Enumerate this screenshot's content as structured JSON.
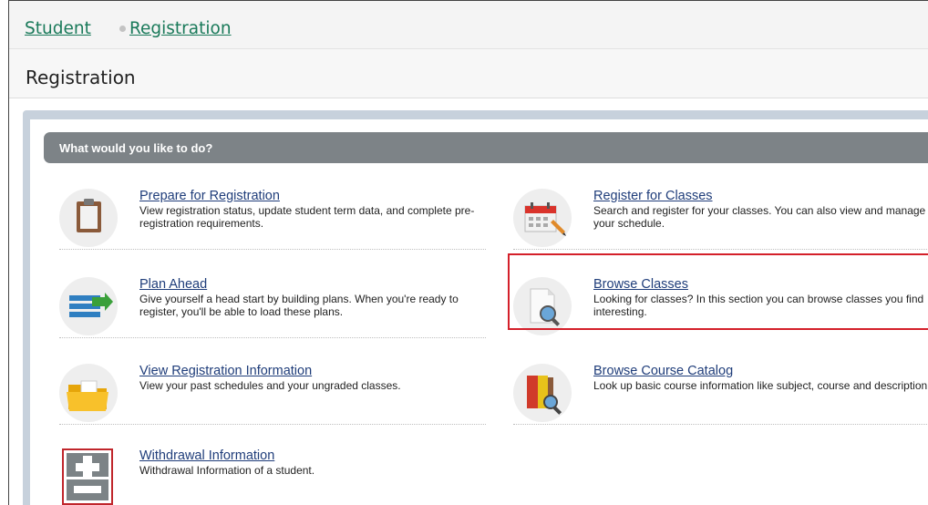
{
  "breadcrumb": {
    "items": [
      "Student",
      "Registration"
    ]
  },
  "page": {
    "title": "Registration"
  },
  "section": {
    "header": "What would you like to do?"
  },
  "tasks": [
    {
      "title": "Prepare for Registration",
      "description": "View registration status, update student term data, and complete pre-registration requirements.",
      "icon": "clipboard-icon"
    },
    {
      "title": "Register for Classes",
      "description": "Search and register for your classes. You can also view and manage your schedule.",
      "icon": "calendar-icon"
    },
    {
      "title": "Plan Ahead",
      "description": "Give yourself a head start by building plans. When you're ready to register, you'll be able to load these plans.",
      "icon": "plan-list-icon"
    },
    {
      "title": "Browse Classes",
      "description": "Looking for classes? In this section you can browse classes you find interesting.",
      "icon": "document-search-icon"
    },
    {
      "title": "View Registration Information",
      "description": "View your past schedules and your ungraded classes.",
      "icon": "folder-icon"
    },
    {
      "title": "Browse Course Catalog",
      "description": "Look up basic course information like subject, course and description.",
      "icon": "catalog-search-icon"
    },
    {
      "title": "Withdrawal Information",
      "description": "Withdrawal Information of a student.",
      "icon": "plus-minus-icon"
    }
  ],
  "colors": {
    "link": "#1f3d7a",
    "breadcrumb_link": "#1a7a5a",
    "header_bg": "#7d8387",
    "highlight": "#d4202a",
    "panel_border": "#c7d1dc"
  }
}
